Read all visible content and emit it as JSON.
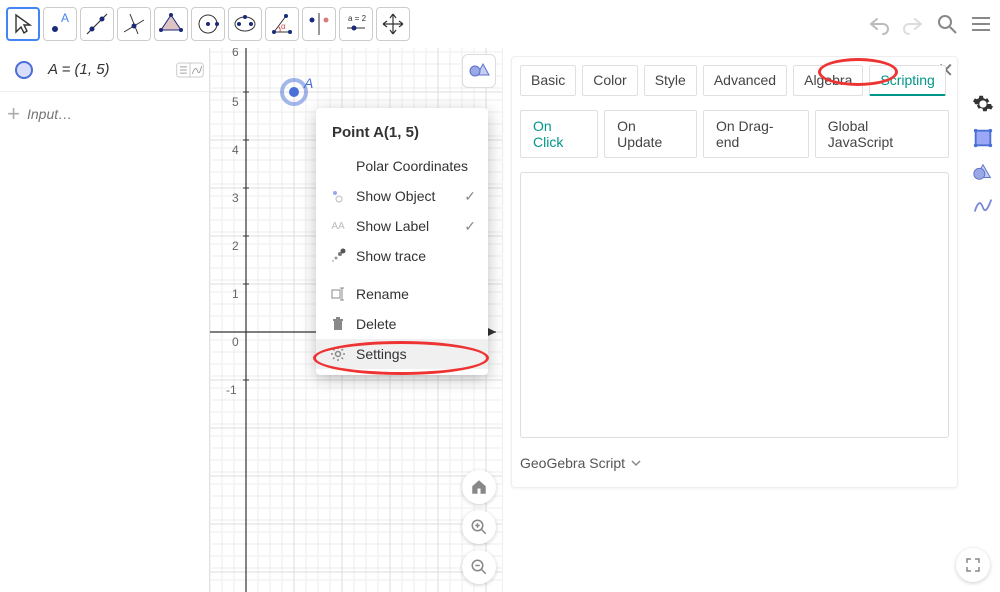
{
  "toolbar": {
    "a_equals_label": "a = 2"
  },
  "algebra": {
    "expression": "A = (1, 5)",
    "input_placeholder": "Input…"
  },
  "graph": {
    "y_ticks": [
      "6",
      "5",
      "4",
      "3",
      "2",
      "1",
      "-1"
    ],
    "x_ticks": [
      "0"
    ],
    "point_label": "A"
  },
  "context_menu": {
    "title": "Point A(1, 5)",
    "items": {
      "polar": "Polar Coordinates",
      "show_object": "Show Object",
      "show_label": "Show Label",
      "show_trace": "Show trace",
      "rename": "Rename",
      "delete": "Delete",
      "settings": "Settings"
    }
  },
  "panel": {
    "tabs": {
      "basic": "Basic",
      "color": "Color",
      "style": "Style",
      "advanced": "Advanced",
      "algebra": "Algebra",
      "scripting": "Scripting"
    },
    "subtabs": {
      "on_click": "On Click",
      "on_update": "On Update",
      "on_drag_end": "On Drag-end",
      "global_js": "Global JavaScript"
    },
    "script_type": "GeoGebra Script"
  }
}
